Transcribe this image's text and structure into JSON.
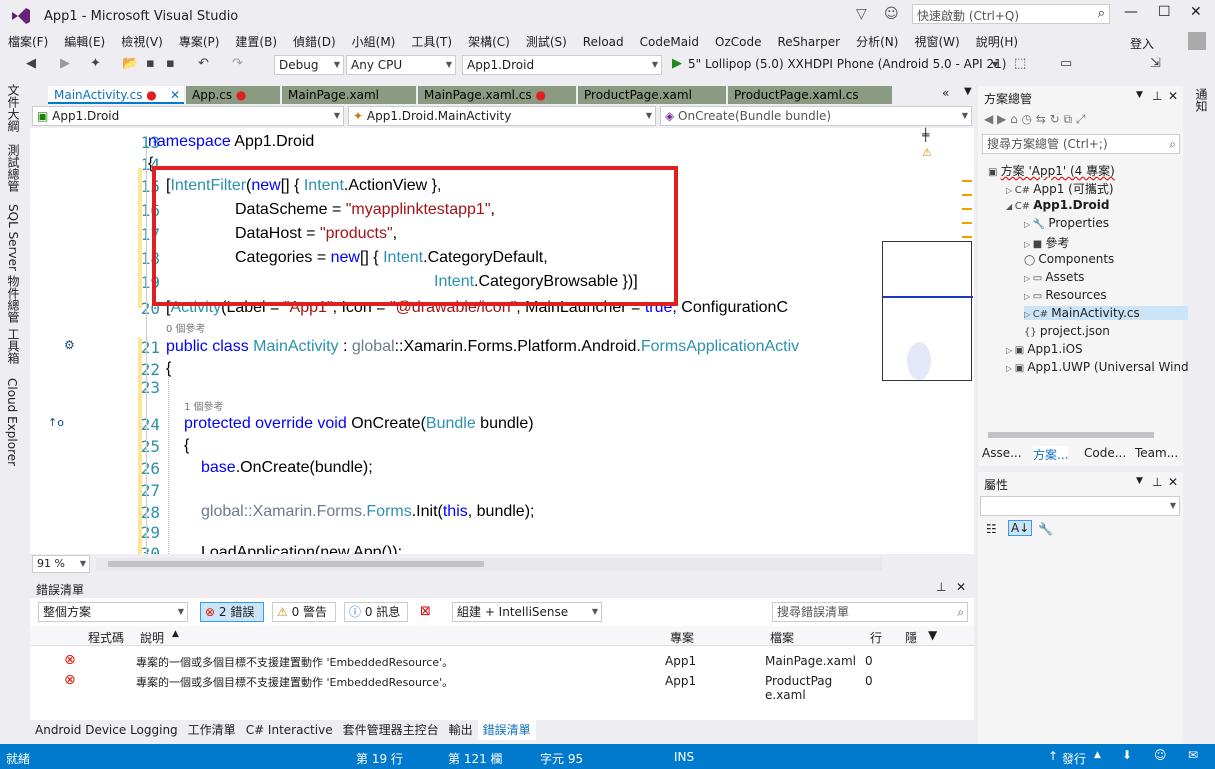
{
  "window": {
    "title": "App1 - Microsoft Visual Studio",
    "quick_launch": "快速啟動 (Ctrl+Q)",
    "signin": "登入"
  },
  "menu": [
    "檔案(F)",
    "編輯(E)",
    "檢視(V)",
    "專案(P)",
    "建置(B)",
    "偵錯(D)",
    "小組(M)",
    "工具(T)",
    "架構(C)",
    "測試(S)",
    "Reload",
    "CodeMaid",
    "OzCode",
    "ReSharper",
    "分析(N)",
    "視窗(W)",
    "說明(H)"
  ],
  "toolbar": {
    "config": "Debug",
    "platform": "Any CPU",
    "project": "App1.Droid",
    "run_target": "5\" Lollipop (5.0) XXHDPI Phone (Android 5.0 - API 21)"
  },
  "left_tabs": [
    "文件大綱",
    "測試總管",
    "SQL Server 物件總管",
    "工具箱",
    "Cloud Explorer"
  ],
  "doc_tabs": [
    "MainActivity.cs",
    "App.cs",
    "MainPage.xaml",
    "MainPage.xaml.cs",
    "ProductPage.xaml",
    "ProductPage.xaml.cs"
  ],
  "nav": {
    "project": "App1.Droid",
    "class": "App1.Droid.MainActivity",
    "member": "OnCreate(Bundle bundle)"
  },
  "lines": [
    "13",
    "14",
    "15",
    "16",
    "17",
    "18",
    "19",
    "20",
    "21",
    "22",
    "23",
    "24",
    "25",
    "26",
    "27",
    "28",
    "29",
    "30"
  ],
  "code": {
    "l13a": "namespace",
    "l13b": " App1.Droid",
    "l14": "{",
    "l15a": "[",
    "l15b": "IntentFilter",
    "l15c": "(",
    "l15d": "new",
    "l15e": "[] { ",
    "l15f": "Intent",
    ".l15g": "",
    "l15h": ".ActionView },",
    "l16a": "DataScheme = ",
    "l16b": "\"myapplinktestapp1\"",
    "l16c": ",",
    "l17a": "DataHost = ",
    "l17b": "\"products\"",
    "l17c": ",",
    "l18a": "Categories = ",
    "l18b": "new",
    "l18c": "[] { ",
    "l18d": "Intent",
    "l18e": ".CategoryDefault,",
    "l19a": "Intent",
    "l19b": ".CategoryBrowsable })]",
    "l20a": "[",
    "l20b": "Activity",
    "l20c": "(Label = ",
    "l20d": "\"App1\"",
    "l20e": ", Icon = ",
    "l20f": "\"@drawable/icon\"",
    "l20g": ", MainLauncher = ",
    "l20h": "true",
    "l20i": ", ConfigurationC",
    "ref0": "0 個參考",
    "l21a": "public class ",
    "l21b": "MainActivity",
    "l21c": " : ",
    "l21d": "global",
    "l21e": "::Xamarin.Forms.Platform.Android.",
    "l21f": "FormsApplicationActiv",
    "l22": "{",
    "ref1": "1 個參考",
    "l24a": "protected override void ",
    "l24b": "OnCreate(",
    "l24c": "Bundle",
    "l24d": " bundle)",
    "l25": "{",
    "l26a": "base",
    "l26b": ".OnCreate(bundle);",
    "l28a": "global",
    "l28b": "::Xamarin.Forms.",
    "l28c": "Forms",
    "l28d": ".Init(",
    "l28e": "this",
    "l28f": ", bundle);",
    "l30": "LoadApplication(new App());"
  },
  "zoom": "91 %",
  "errors": {
    "title": "錯誤清單",
    "scope": "整個方案",
    "err_btn": "2 錯誤",
    "warn_btn": "0 警告",
    "msg_btn": "0 訊息",
    "build": "組建 + IntelliSense",
    "search": "搜尋錯誤清單",
    "cols": [
      "程式碼",
      "說明",
      "專案",
      "檔案",
      "行",
      "隱"
    ],
    "rows": [
      {
        "desc": "專案的一個或多個目標不支援建置動作 'EmbeddedResource'。",
        "project": "App1",
        "file": "MainPage.xaml",
        "line": "0"
      },
      {
        "desc": "專案的一個或多個目標不支援建置動作 'EmbeddedResource'。",
        "project": "App1",
        "file": "ProductPage.xaml",
        "line": "0"
      }
    ]
  },
  "bottom_tabs": [
    "Android Device Logging",
    "工作清單",
    "C# Interactive",
    "套件管理器主控台",
    "輸出",
    "錯誤清單"
  ],
  "status": {
    "ready": "就緒",
    "line": "第 19 行",
    "col": "第 121 欄",
    "char": "字元 95",
    "ins": "INS",
    "publish": "發行"
  },
  "solution": {
    "title": "方案總管",
    "search": "搜尋方案總管 (Ctrl+;)",
    "items": [
      {
        "label": "方案 'App1' (4 專案)",
        "indent": 0
      },
      {
        "label": "App1 (可攜式)",
        "indent": 1
      },
      {
        "label": "App1.Droid",
        "indent": 1
      },
      {
        "label": "Properties",
        "indent": 2
      },
      {
        "label": "參考",
        "indent": 2
      },
      {
        "label": "Components",
        "indent": 2
      },
      {
        "label": "Assets",
        "indent": 2
      },
      {
        "label": "Resources",
        "indent": 2
      },
      {
        "label": "MainActivity.cs",
        "indent": 2
      },
      {
        "label": "project.json",
        "indent": 2
      },
      {
        "label": "App1.iOS",
        "indent": 1
      },
      {
        "label": "App1.UWP (Universal Wind",
        "indent": 1
      }
    ],
    "tabs": [
      "Asse...",
      "方案...",
      "Code...",
      "Team..."
    ]
  },
  "properties": {
    "title": "屬性"
  },
  "right_tab": "通知"
}
